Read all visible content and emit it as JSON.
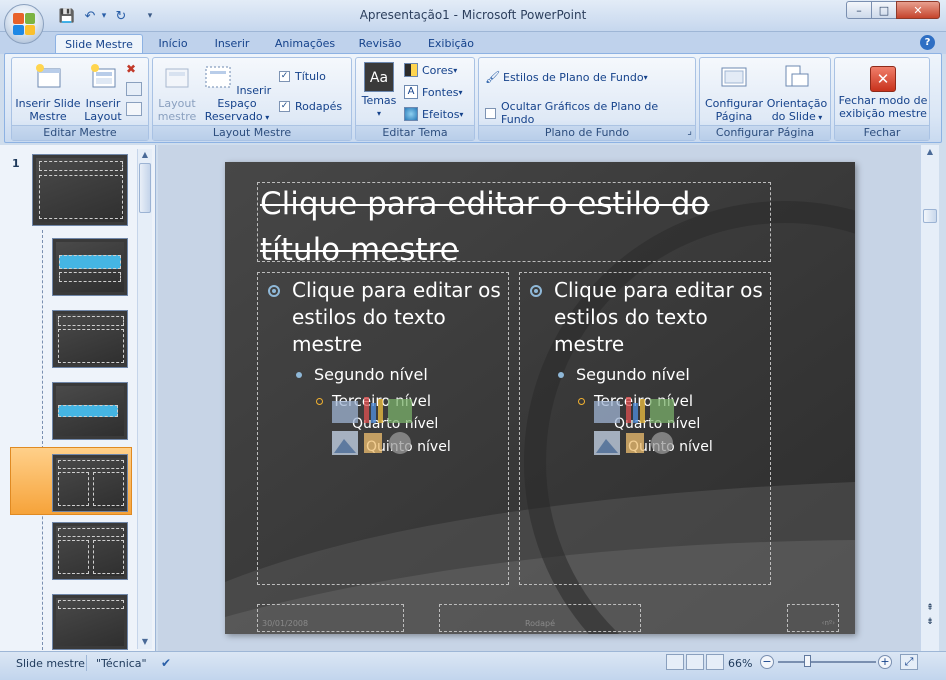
{
  "window": {
    "title": "Apresentação1 - Microsoft PowerPoint",
    "controls": {
      "minimize": "–",
      "maximize": "□",
      "close": "✕"
    }
  },
  "qat": {
    "save": "💾",
    "undo": "↶",
    "redo": "↻",
    "customize": "▾"
  },
  "tabs": [
    {
      "label": "Slide Mestre",
      "active": true
    },
    {
      "label": "Início"
    },
    {
      "label": "Inserir"
    },
    {
      "label": "Animações"
    },
    {
      "label": "Revisão"
    },
    {
      "label": "Exibição"
    }
  ],
  "help_icon": "?",
  "ribbon": {
    "editar_mestre": {
      "label": "Editar Mestre",
      "insert_master": "Inserir Slide Mestre",
      "insert_layout": "Inserir Layout"
    },
    "layout_mestre": {
      "label": "Layout Mestre",
      "layout_master": "Layout mestre",
      "insert_placeholder": "Inserir Espaço Reservado",
      "title_checkbox": "Título",
      "footer_checkbox": "Rodapés"
    },
    "editar_tema": {
      "label": "Editar Tema",
      "themes": "Temas",
      "theme_preview": "Aa",
      "colors": "Cores",
      "fonts": "Fontes",
      "fonts_icon": "A",
      "effects": "Efeitos"
    },
    "plano_fundo": {
      "label": "Plano de Fundo",
      "bg_styles": "Estilos de Plano de Fundo",
      "hide_graphics": "Ocultar Gráficos de Plano de Fundo",
      "launcher_icon": "⌟"
    },
    "configurar_pagina": {
      "label": "Configurar Página",
      "page_setup": "Configurar Página",
      "orientation": "Orientação do Slide"
    },
    "fechar": {
      "label": "Fechar",
      "close_master": "Fechar modo de exibição mestre",
      "close_icon": "✕"
    }
  },
  "slide_pane": {
    "number": "1"
  },
  "slide": {
    "title": "Clique para editar o estilo do título mestre",
    "left": {
      "level1": "Clique para editar os estilos do texto mestre",
      "level2": "Segundo nível",
      "level3": "Terceiro nível",
      "level4": "Quarto nível",
      "level5": "Quinto nível"
    },
    "right": {
      "level1": "Clique para editar os estilos do texto mestre",
      "level2": "Segundo nível",
      "level3": "Terceiro nível",
      "level4": "Quarto nível",
      "level5": "Quinto nível"
    },
    "date": "30/01/2008",
    "footer": "Rodapé",
    "page_number": "‹nº›"
  },
  "status": {
    "view": "Slide mestre",
    "theme": "\"Técnica\"",
    "zoom": "66%",
    "zoom_out": "−",
    "zoom_in": "+",
    "fit_icon": "⤢"
  }
}
